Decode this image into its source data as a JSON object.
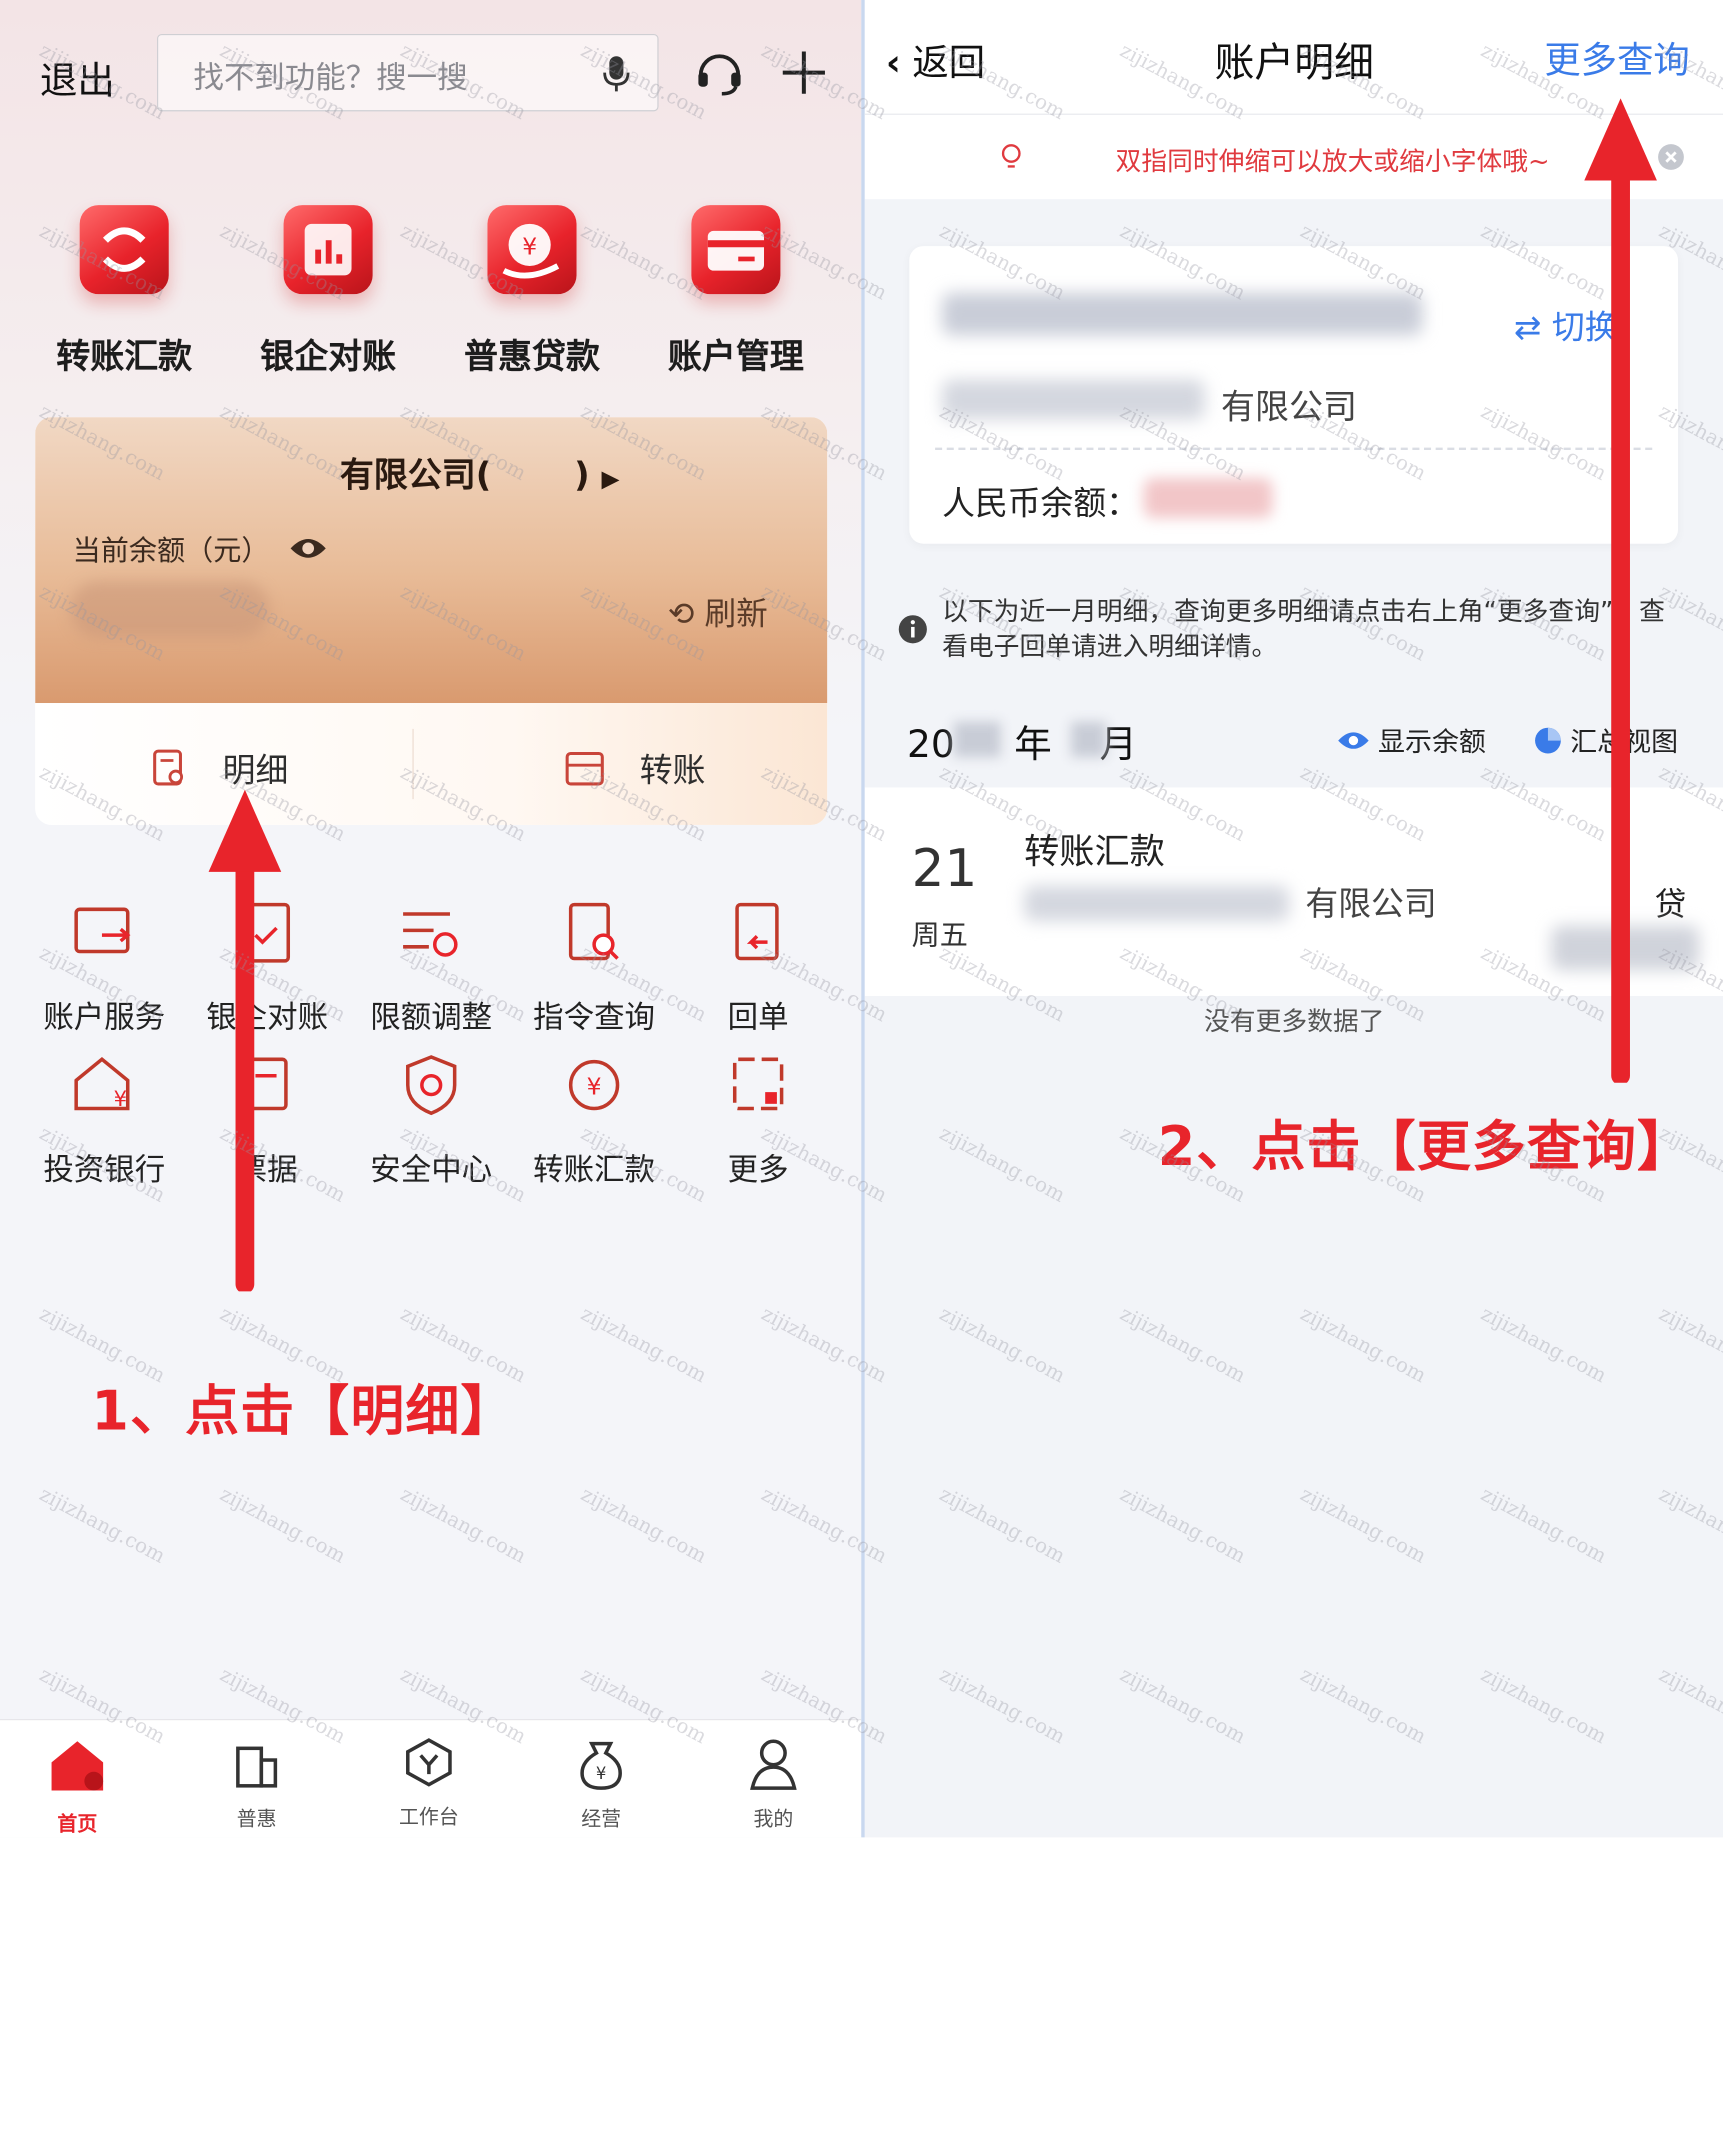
{
  "left": {
    "header": {
      "exit_label": "退出",
      "search_placeholder": "找不到功能？搜一搜"
    },
    "quick_actions": [
      {
        "label": "转账汇款",
        "icon": "transfer-icon"
      },
      {
        "label": "银企对账",
        "icon": "reconcile-chart-icon"
      },
      {
        "label": "普惠贷款",
        "icon": "loan-icon"
      },
      {
        "label": "账户管理",
        "icon": "card-icon"
      }
    ],
    "account_card": {
      "company_prefix": "有限公司(",
      "company_suffix": ")",
      "balance_label": "当前余额（元）",
      "refresh_label": "刷新",
      "tab_detail": "明细",
      "tab_transfer": "转账"
    },
    "grid": [
      {
        "label": "账户服务",
        "icon": "account-service-icon"
      },
      {
        "label": "银企对账",
        "icon": "reconcile-icon"
      },
      {
        "label": "限额调整",
        "icon": "limit-adjust-icon"
      },
      {
        "label": "指令查询",
        "icon": "instruction-query-icon"
      },
      {
        "label": "回单",
        "icon": "receipt-icon"
      },
      {
        "label": "投资银行",
        "icon": "investment-bank-icon"
      },
      {
        "label": "票据",
        "icon": "bill-icon"
      },
      {
        "label": "安全中心",
        "icon": "security-center-icon"
      },
      {
        "label": "转账汇款",
        "icon": "transfer-yuan-icon"
      },
      {
        "label": "更多",
        "icon": "more-grid-icon"
      }
    ],
    "instruction": "1、点击【明细】",
    "tabbar": [
      {
        "label": "首页",
        "icon": "home-icon",
        "active": true
      },
      {
        "label": "普惠",
        "icon": "building-icon",
        "active": false
      },
      {
        "label": "工作台",
        "icon": "workbench-icon",
        "active": false
      },
      {
        "label": "经营",
        "icon": "money-bag-icon",
        "active": false
      },
      {
        "label": "我的",
        "icon": "user-icon",
        "active": false
      }
    ]
  },
  "right": {
    "nav": {
      "back_label": "返回",
      "title": "账户明细",
      "more_query": "更多查询"
    },
    "tip": "双指同时伸缩可以放大或缩小字体哦~",
    "account": {
      "switch_label": "切换",
      "company": "有限公司",
      "rmb_balance_label": "人民币余额："
    },
    "note": "以下为近一月明细，查询更多明细请点击右上角“更多查询”。查看电子回单请进入明细详情。",
    "month": {
      "prefix": "20",
      "year_unit": "年",
      "month_unit": "月"
    },
    "show_balance": "显示余额",
    "summary_view": "汇总视图",
    "transaction": {
      "day": "21",
      "weekday": "周五",
      "title": "转账汇款",
      "company": "有限公司",
      "direction": "贷"
    },
    "no_more": "没有更多数据了",
    "instruction": "2、点击【更多查询】"
  },
  "watermark": "zijizhang.com",
  "colors": {
    "brand_red": "#e8242b",
    "link_blue": "#3a7be8"
  }
}
